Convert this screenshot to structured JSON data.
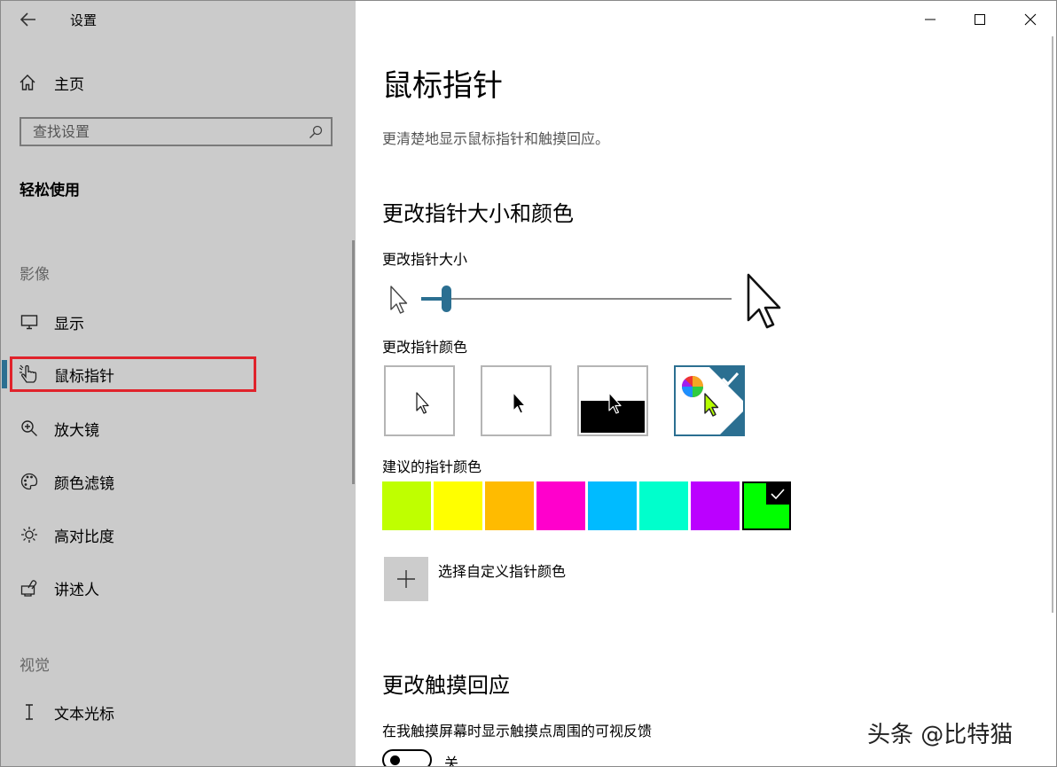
{
  "window": {
    "app_title": "设置"
  },
  "sidebar": {
    "home_label": "主页",
    "search_placeholder": "查找设置",
    "section_title": "轻松使用",
    "groups": {
      "vision": "影像",
      "vision2": "视觉"
    },
    "items": {
      "display": "显示",
      "mouse_pointer": "鼠标指针",
      "magnifier": "放大镜",
      "color_filters": "颜色滤镜",
      "high_contrast": "高对比度",
      "narrator": "讲述人",
      "text_cursor": "文本光标"
    },
    "selected_item": "mouse_pointer"
  },
  "main": {
    "page_title": "鼠标指针",
    "page_description": "更清楚地显示鼠标指针和触摸回应。",
    "size_color_heading": "更改指针大小和颜色",
    "size_label": "更改指针大小",
    "size_slider_fraction": 0.08,
    "color_label": "更改指针颜色",
    "color_options": [
      "white",
      "black",
      "inverted",
      "custom"
    ],
    "selected_color_option": "custom",
    "suggested_label": "建议的指针颜色",
    "suggested_colors": [
      "#bfff00",
      "#ffff00",
      "#ffbb00",
      "#ff00cc",
      "#00bbff",
      "#00ffcc",
      "#bb00ff",
      "#00ff00"
    ],
    "selected_suggested_index": 7,
    "custom_color_label": "选择自定义指针颜色",
    "touch_heading": "更改触摸回应",
    "touch_feedback_label": "在我触摸屏幕时显示触摸点周围的可视反馈",
    "touch_feedback_state": "关"
  },
  "colors": {
    "accent": "#2b6f91",
    "sidebar_bg": "#cbcbcb",
    "highlight_box": "#e0232b"
  },
  "watermark": "头条 @比特猫"
}
